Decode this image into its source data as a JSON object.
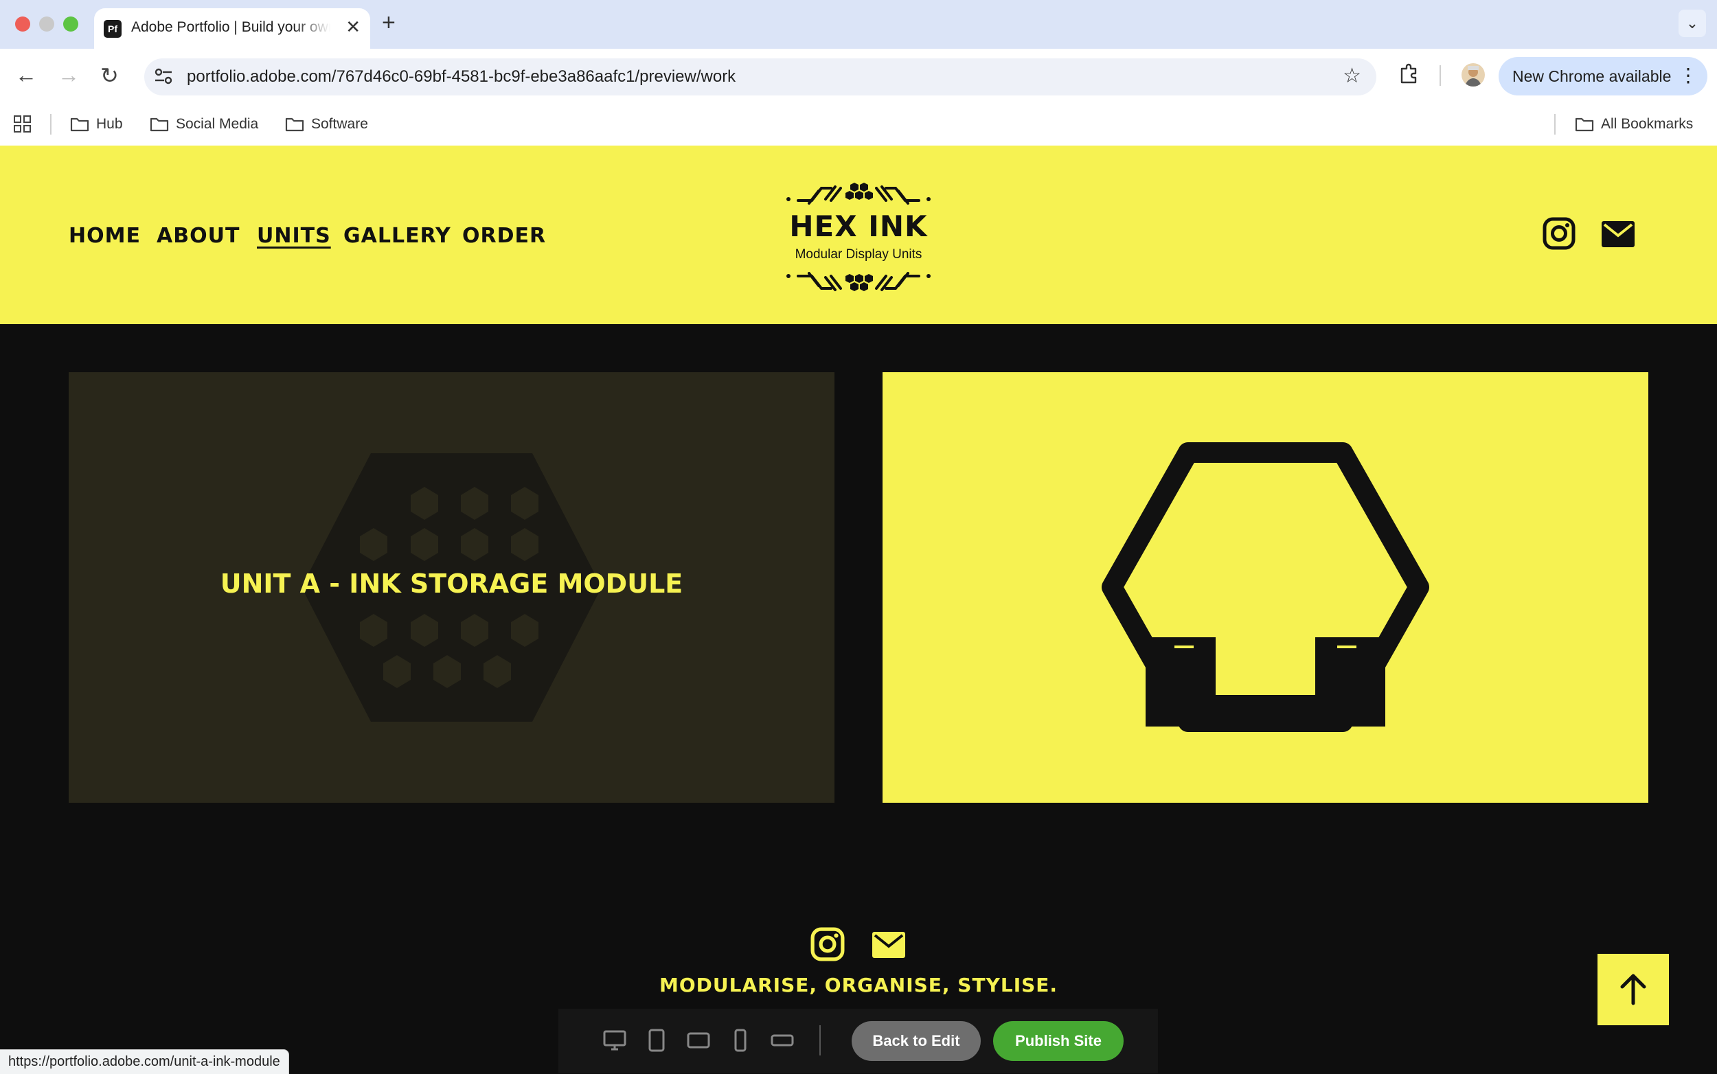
{
  "browser": {
    "tab_title": "Adobe Portfolio | Build your own personalized website",
    "tab_favicon": "Pf",
    "url": "portfolio.adobe.com/767d46c0-69bf-4581-bc9f-ebe3a86aafc1/preview/work",
    "update_label": "New Chrome available",
    "bookmarks": [
      "Hub",
      "Social Media",
      "Software"
    ],
    "all_bookmarks": "All Bookmarks",
    "status_url": "https://portfolio.adobe.com/unit-a-ink-module"
  },
  "site": {
    "nav": [
      "HOME",
      "ABOUT",
      "UNITS",
      "GALLERY",
      "ORDER"
    ],
    "active_nav": "UNITS",
    "logo_title": "HEX INK",
    "logo_subtitle": "Modular Display Units",
    "tagline": "MODULARISE, ORGANISE, STYLISE.",
    "projects": [
      {
        "title": "Unit A - Ink Storage Module"
      }
    ]
  },
  "preview_bar": {
    "back_label": "Back to Edit",
    "publish_label": "Publish Site"
  },
  "colors": {
    "brand_yellow": "#f6f252",
    "dark": "#0e0e0e",
    "publish_green": "#46a832"
  }
}
